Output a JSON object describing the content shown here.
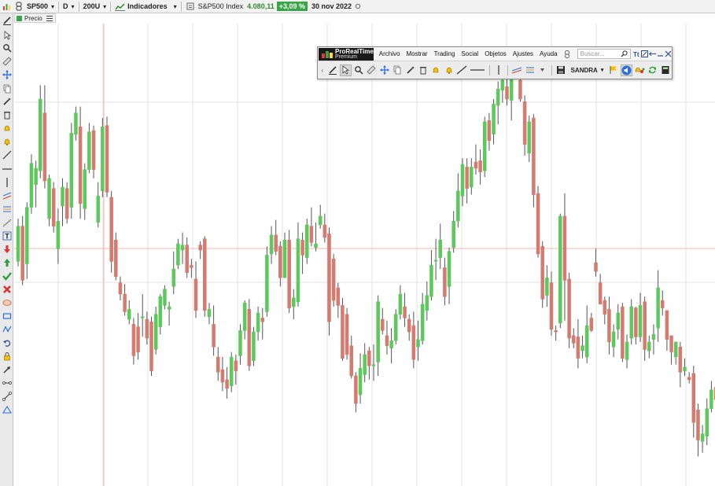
{
  "topbar": {
    "symbol": "SP500",
    "period": "D",
    "units": "200U",
    "indicators_label": "Indicadores",
    "instrument_name": "S&P500 Index",
    "last_price": "4.080,11",
    "change_pct": "+3,09 %",
    "date": "30 nov 2022"
  },
  "chart_tag": {
    "label": "Precio"
  },
  "floating_window": {
    "brand_line1": "ProRealTime",
    "brand_line2": "Premium",
    "menu": [
      "Archivo",
      "Mostrar",
      "Trading",
      "Social",
      "Objetos",
      "Ajustes",
      "Ayuda"
    ],
    "search_placeholder": "Buscar...",
    "user_label": "SANDRA"
  },
  "colors": {
    "bull": "#5cc95c",
    "bear": "#d47a6f",
    "up_green": "#3aa547",
    "grid": "#e3e3e3",
    "crosshair": "#f0b5b0"
  },
  "chart_data": {
    "type": "candlestick",
    "instrument": "SP500",
    "interval": "D",
    "candles": [
      [
        162,
        190,
        196,
        158
      ],
      [
        190,
        147,
        198,
        143
      ],
      [
        160,
        205,
        209,
        148
      ],
      [
        205,
        240,
        247,
        200
      ],
      [
        223,
        236,
        242,
        205
      ],
      [
        234,
        291,
        302,
        228
      ],
      [
        280,
        226,
        302,
        220
      ],
      [
        196,
        228,
        231,
        190
      ],
      [
        220,
        190,
        225,
        185
      ],
      [
        172,
        194,
        204,
        160
      ],
      [
        206,
        221,
        228,
        190
      ],
      [
        220,
        196,
        225,
        192
      ],
      [
        205,
        264,
        272,
        196
      ],
      [
        263,
        280,
        285,
        258
      ],
      [
        269,
        208,
        285,
        196
      ],
      [
        204,
        235,
        240,
        195
      ],
      [
        235,
        265,
        272,
        232
      ],
      [
        266,
        235,
        270,
        228
      ],
      [
        193,
        214,
        225,
        189
      ],
      [
        218,
        269,
        276,
        213
      ],
      [
        270,
        217,
        277,
        213
      ],
      [
        213,
        162,
        218,
        153
      ],
      [
        179,
        150,
        185,
        147
      ],
      [
        145,
        136,
        150,
        131
      ],
      [
        136,
        122,
        144,
        119
      ],
      [
        116,
        124,
        131,
        112
      ],
      [
        112,
        87,
        117,
        80
      ],
      [
        110,
        90,
        121,
        84
      ],
      [
        118,
        118,
        136,
        102
      ],
      [
        116,
        101,
        122,
        96
      ],
      [
        114,
        75,
        118,
        71
      ],
      [
        92,
        120,
        126,
        88
      ],
      [
        110,
        134,
        136,
        104
      ],
      [
        127,
        140,
        143,
        124
      ],
      [
        124,
        126,
        130,
        111
      ],
      [
        142,
        156,
        170,
        136
      ],
      [
        159,
        176,
        180,
        156
      ],
      [
        171,
        175,
        185,
        160
      ],
      [
        175,
        153,
        181,
        149
      ],
      [
        159,
        157,
        164,
        149
      ],
      [
        148,
        123,
        162,
        117
      ],
      [
        175,
        171,
        178,
        164
      ],
      [
        180,
        123,
        182,
        118
      ],
      [
        118,
        124,
        129,
        112
      ],
      [
        112,
        94,
        127,
        87
      ],
      [
        86,
        74,
        94,
        67
      ],
      [
        76,
        66,
        86,
        59
      ],
      [
        68,
        61,
        78,
        53
      ],
      [
        63,
        86,
        90,
        58
      ],
      [
        83,
        75,
        88,
        64
      ],
      [
        87,
        107,
        112,
        80
      ],
      [
        107,
        129,
        131,
        100
      ],
      [
        124,
        79,
        132,
        75
      ],
      [
        83,
        106,
        110,
        79
      ],
      [
        106,
        121,
        126,
        99
      ],
      [
        117,
        114,
        125,
        100
      ],
      [
        122,
        167,
        174,
        118
      ],
      [
        168,
        183,
        190,
        160
      ],
      [
        183,
        170,
        195,
        167
      ],
      [
        174,
        149,
        178,
        142
      ],
      [
        149,
        179,
        185,
        149
      ],
      [
        179,
        125,
        187,
        121
      ],
      [
        126,
        133,
        140,
        116
      ],
      [
        130,
        180,
        193,
        126
      ],
      [
        179,
        167,
        185,
        152
      ],
      [
        165,
        191,
        196,
        160
      ],
      [
        190,
        177,
        205,
        174
      ],
      [
        173,
        176,
        193,
        170
      ],
      [
        191,
        198,
        207,
        188
      ],
      [
        191,
        181,
        200,
        177
      ],
      [
        184,
        114,
        189,
        103
      ],
      [
        164,
        131,
        168,
        126
      ],
      [
        141,
        127,
        145,
        117
      ],
      [
        127,
        85,
        133,
        83
      ],
      [
        120,
        88,
        125,
        84
      ],
      [
        95,
        71,
        103,
        69
      ],
      [
        71,
        49,
        74,
        42
      ],
      [
        56,
        77,
        89,
        49
      ],
      [
        72,
        88,
        97,
        66
      ],
      [
        91,
        79,
        94,
        68
      ],
      [
        79,
        80,
        96,
        67
      ],
      [
        82,
        130,
        135,
        71
      ],
      [
        116,
        107,
        125,
        104
      ],
      [
        103,
        95,
        115,
        88
      ],
      [
        93,
        99,
        109,
        81
      ],
      [
        99,
        120,
        124,
        96
      ],
      [
        120,
        136,
        143,
        116
      ],
      [
        126,
        117,
        137,
        110
      ],
      [
        116,
        106,
        120,
        99
      ],
      [
        111,
        84,
        122,
        77
      ],
      [
        94,
        100,
        115,
        83
      ],
      [
        99,
        128,
        137,
        96
      ],
      [
        123,
        135,
        146,
        115
      ],
      [
        134,
        159,
        171,
        131
      ],
      [
        163,
        163,
        180,
        147
      ],
      [
        165,
        179,
        192,
        156
      ],
      [
        157,
        134,
        165,
        127
      ],
      [
        142,
        170,
        173,
        128
      ],
      [
        173,
        194,
        202,
        169
      ],
      [
        194,
        218,
        232,
        189
      ],
      [
        214,
        239,
        244,
        206
      ],
      [
        237,
        220,
        244,
        208
      ],
      [
        221,
        237,
        244,
        215
      ],
      [
        241,
        236,
        255,
        231
      ],
      [
        242,
        233,
        251,
        223
      ],
      [
        234,
        273,
        277,
        229
      ],
      [
        274,
        258,
        280,
        250
      ],
      [
        263,
        287,
        291,
        255
      ],
      [
        286,
        299,
        305,
        271
      ],
      [
        298,
        306,
        308,
        288
      ],
      [
        301,
        291,
        309,
        286
      ],
      [
        290,
        312,
        315,
        274
      ],
      [
        318,
        314,
        321,
        309
      ],
      [
        306,
        291,
        313,
        289
      ],
      [
        289,
        255,
        294,
        246
      ],
      [
        248,
        273,
        278,
        241
      ],
      [
        276,
        215,
        279,
        205
      ],
      [
        216,
        168,
        222,
        165
      ],
      [
        174,
        132,
        178,
        125
      ],
      [
        135,
        149,
        159,
        126
      ],
      [
        145,
        108,
        154,
        103
      ],
      [
        107,
        106,
        111,
        99
      ],
      [
        113,
        198,
        200,
        109
      ],
      [
        198,
        147,
        216,
        115
      ],
      [
        148,
        101,
        153,
        93
      ],
      [
        103,
        97,
        109,
        93
      ],
      [
        102,
        85,
        116,
        77
      ],
      [
        91,
        95,
        103,
        85
      ],
      [
        86,
        111,
        127,
        81
      ],
      [
        117,
        107,
        121,
        106
      ],
      [
        161,
        154,
        172,
        150
      ],
      [
        145,
        128,
        152,
        128
      ],
      [
        131,
        120,
        134,
        112
      ],
      [
        124,
        98,
        134,
        88
      ],
      [
        94,
        106,
        112,
        86
      ],
      [
        108,
        121,
        128,
        100
      ],
      [
        126,
        85,
        129,
        82
      ],
      [
        84,
        98,
        104,
        77
      ],
      [
        101,
        126,
        132,
        96
      ],
      [
        125,
        102,
        126,
        96
      ],
      [
        102,
        127,
        137,
        98
      ],
      [
        130,
        92,
        134,
        83
      ],
      [
        91,
        98,
        103,
        85
      ],
      [
        100,
        104,
        112,
        88
      ],
      [
        109,
        141,
        155,
        98
      ],
      [
        131,
        125,
        139,
        119
      ],
      [
        123,
        100,
        123,
        91
      ],
      [
        103,
        90,
        102,
        80
      ],
      [
        86,
        98,
        98,
        80
      ],
      [
        94,
        74,
        98,
        62
      ],
      [
        75,
        78,
        85,
        71
      ],
      [
        70,
        68,
        74,
        65
      ],
      [
        73,
        34,
        79,
        22
      ],
      [
        44,
        20,
        49,
        7
      ],
      [
        19,
        25,
        32,
        10
      ],
      [
        23,
        45,
        53,
        16
      ],
      [
        45,
        60,
        67,
        42
      ],
      [
        62,
        52,
        74,
        48
      ],
      [
        49,
        58,
        62,
        44
      ],
      [
        57,
        58,
        67,
        54
      ]
    ]
  }
}
